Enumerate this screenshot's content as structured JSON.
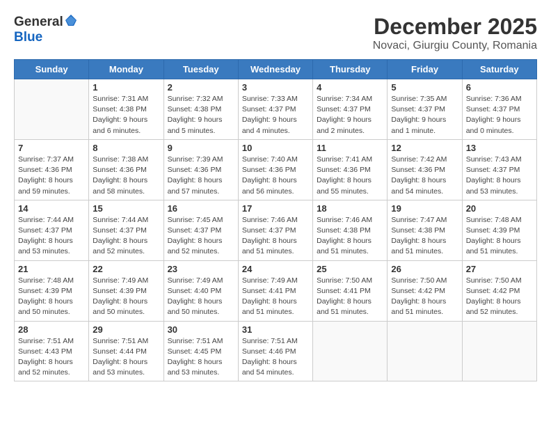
{
  "header": {
    "logo_general": "General",
    "logo_blue": "Blue",
    "month": "December 2025",
    "location": "Novaci, Giurgiu County, Romania"
  },
  "days_of_week": [
    "Sunday",
    "Monday",
    "Tuesday",
    "Wednesday",
    "Thursday",
    "Friday",
    "Saturday"
  ],
  "weeks": [
    [
      {
        "day": "",
        "info": ""
      },
      {
        "day": "1",
        "info": "Sunrise: 7:31 AM\nSunset: 4:38 PM\nDaylight: 9 hours\nand 6 minutes."
      },
      {
        "day": "2",
        "info": "Sunrise: 7:32 AM\nSunset: 4:38 PM\nDaylight: 9 hours\nand 5 minutes."
      },
      {
        "day": "3",
        "info": "Sunrise: 7:33 AM\nSunset: 4:37 PM\nDaylight: 9 hours\nand 4 minutes."
      },
      {
        "day": "4",
        "info": "Sunrise: 7:34 AM\nSunset: 4:37 PM\nDaylight: 9 hours\nand 2 minutes."
      },
      {
        "day": "5",
        "info": "Sunrise: 7:35 AM\nSunset: 4:37 PM\nDaylight: 9 hours\nand 1 minute."
      },
      {
        "day": "6",
        "info": "Sunrise: 7:36 AM\nSunset: 4:37 PM\nDaylight: 9 hours\nand 0 minutes."
      }
    ],
    [
      {
        "day": "7",
        "info": "Sunrise: 7:37 AM\nSunset: 4:36 PM\nDaylight: 8 hours\nand 59 minutes."
      },
      {
        "day": "8",
        "info": "Sunrise: 7:38 AM\nSunset: 4:36 PM\nDaylight: 8 hours\nand 58 minutes."
      },
      {
        "day": "9",
        "info": "Sunrise: 7:39 AM\nSunset: 4:36 PM\nDaylight: 8 hours\nand 57 minutes."
      },
      {
        "day": "10",
        "info": "Sunrise: 7:40 AM\nSunset: 4:36 PM\nDaylight: 8 hours\nand 56 minutes."
      },
      {
        "day": "11",
        "info": "Sunrise: 7:41 AM\nSunset: 4:36 PM\nDaylight: 8 hours\nand 55 minutes."
      },
      {
        "day": "12",
        "info": "Sunrise: 7:42 AM\nSunset: 4:36 PM\nDaylight: 8 hours\nand 54 minutes."
      },
      {
        "day": "13",
        "info": "Sunrise: 7:43 AM\nSunset: 4:37 PM\nDaylight: 8 hours\nand 53 minutes."
      }
    ],
    [
      {
        "day": "14",
        "info": "Sunrise: 7:44 AM\nSunset: 4:37 PM\nDaylight: 8 hours\nand 53 minutes."
      },
      {
        "day": "15",
        "info": "Sunrise: 7:44 AM\nSunset: 4:37 PM\nDaylight: 8 hours\nand 52 minutes."
      },
      {
        "day": "16",
        "info": "Sunrise: 7:45 AM\nSunset: 4:37 PM\nDaylight: 8 hours\nand 52 minutes."
      },
      {
        "day": "17",
        "info": "Sunrise: 7:46 AM\nSunset: 4:37 PM\nDaylight: 8 hours\nand 51 minutes."
      },
      {
        "day": "18",
        "info": "Sunrise: 7:46 AM\nSunset: 4:38 PM\nDaylight: 8 hours\nand 51 minutes."
      },
      {
        "day": "19",
        "info": "Sunrise: 7:47 AM\nSunset: 4:38 PM\nDaylight: 8 hours\nand 51 minutes."
      },
      {
        "day": "20",
        "info": "Sunrise: 7:48 AM\nSunset: 4:39 PM\nDaylight: 8 hours\nand 51 minutes."
      }
    ],
    [
      {
        "day": "21",
        "info": "Sunrise: 7:48 AM\nSunset: 4:39 PM\nDaylight: 8 hours\nand 50 minutes."
      },
      {
        "day": "22",
        "info": "Sunrise: 7:49 AM\nSunset: 4:39 PM\nDaylight: 8 hours\nand 50 minutes."
      },
      {
        "day": "23",
        "info": "Sunrise: 7:49 AM\nSunset: 4:40 PM\nDaylight: 8 hours\nand 50 minutes."
      },
      {
        "day": "24",
        "info": "Sunrise: 7:49 AM\nSunset: 4:41 PM\nDaylight: 8 hours\nand 51 minutes."
      },
      {
        "day": "25",
        "info": "Sunrise: 7:50 AM\nSunset: 4:41 PM\nDaylight: 8 hours\nand 51 minutes."
      },
      {
        "day": "26",
        "info": "Sunrise: 7:50 AM\nSunset: 4:42 PM\nDaylight: 8 hours\nand 51 minutes."
      },
      {
        "day": "27",
        "info": "Sunrise: 7:50 AM\nSunset: 4:42 PM\nDaylight: 8 hours\nand 52 minutes."
      }
    ],
    [
      {
        "day": "28",
        "info": "Sunrise: 7:51 AM\nSunset: 4:43 PM\nDaylight: 8 hours\nand 52 minutes."
      },
      {
        "day": "29",
        "info": "Sunrise: 7:51 AM\nSunset: 4:44 PM\nDaylight: 8 hours\nand 53 minutes."
      },
      {
        "day": "30",
        "info": "Sunrise: 7:51 AM\nSunset: 4:45 PM\nDaylight: 8 hours\nand 53 minutes."
      },
      {
        "day": "31",
        "info": "Sunrise: 7:51 AM\nSunset: 4:46 PM\nDaylight: 8 hours\nand 54 minutes."
      },
      {
        "day": "",
        "info": ""
      },
      {
        "day": "",
        "info": ""
      },
      {
        "day": "",
        "info": ""
      }
    ]
  ]
}
